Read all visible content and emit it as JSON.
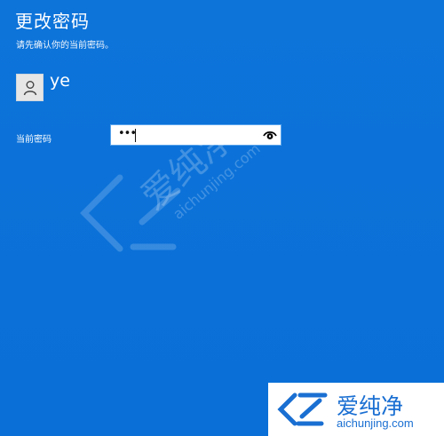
{
  "dialog": {
    "title": "更改密码",
    "subtitle": "请先确认你的当前密码。",
    "account": {
      "username": "ye",
      "avatar_icon": "user-icon"
    },
    "current_password": {
      "label": "当前密码",
      "value": "•••",
      "reveal_icon": "eye-icon"
    }
  },
  "watermark": {
    "brand_cn": "爱纯净",
    "brand_url": "aichunjing.com"
  },
  "logo": {
    "brand_cn": "爱纯净",
    "brand_url": "aichunjing.com"
  },
  "colors": {
    "background": "#0f73d9",
    "text": "#ffffff",
    "logo_blue": "#1a6fd2"
  }
}
